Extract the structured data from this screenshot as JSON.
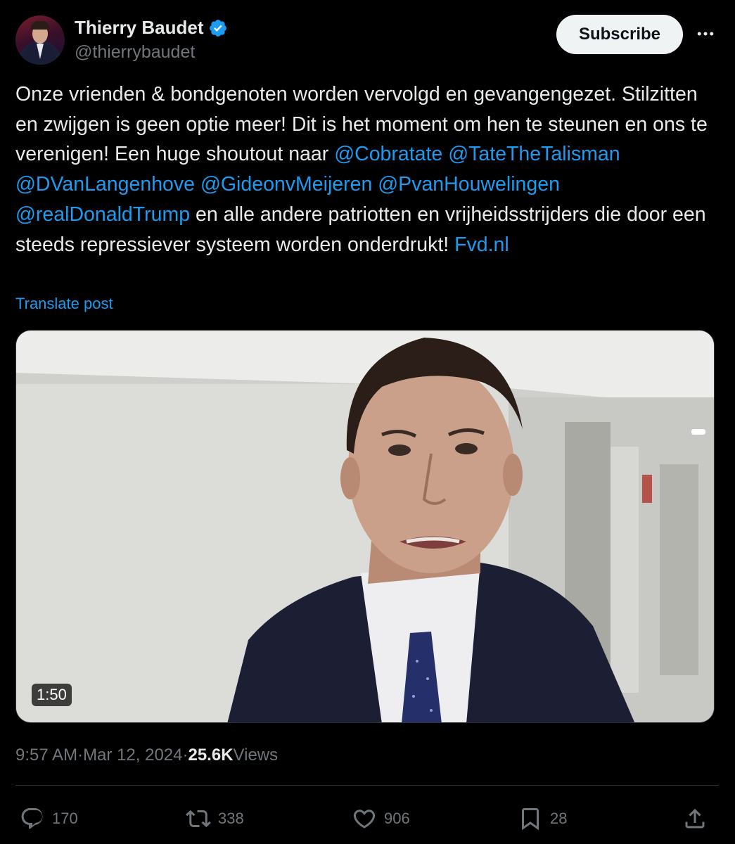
{
  "author": {
    "name": "Thierry Baudet",
    "handle": "@thierrybaudet",
    "verified": true,
    "verified_color": "#1d9bf0"
  },
  "header": {
    "subscribe_label": "Subscribe",
    "more_icon": "more-horizontal-icon"
  },
  "post": {
    "text_segments": [
      {
        "type": "text",
        "value": "Onze vrienden & bondgenoten worden vervolgd en gevangengezet. Stilzitten en zwijgen is geen optie meer! Dit is het moment om hen te steunen en ons te verenigen! Een huge shoutout naar "
      },
      {
        "type": "mention",
        "value": "@Cobratate"
      },
      {
        "type": "text",
        "value": " "
      },
      {
        "type": "mention",
        "value": "@TateTheTalisman"
      },
      {
        "type": "text",
        "value": " "
      },
      {
        "type": "mention",
        "value": "@DVanLangenhove"
      },
      {
        "type": "text",
        "value": " "
      },
      {
        "type": "mention",
        "value": "@GideonvMeijeren"
      },
      {
        "type": "text",
        "value": " "
      },
      {
        "type": "mention",
        "value": "@PvanHouwelingen"
      },
      {
        "type": "text",
        "value": " "
      },
      {
        "type": "mention",
        "value": "@realDonaldTrump"
      },
      {
        "type": "text",
        "value": " en alle andere patriotten en vrijheidsstrijders die door een steeds repressiever systeem worden onderdrukt! "
      },
      {
        "type": "link",
        "value": "Fvd.nl"
      }
    ],
    "translate_label": "Translate post"
  },
  "media": {
    "type": "video",
    "duration": "1:50"
  },
  "meta": {
    "time": "9:57 AM",
    "separator": " · ",
    "date": "Mar 12, 2024",
    "views_count": "25.6K",
    "views_label": " Views"
  },
  "actions": {
    "replies": {
      "icon": "reply-icon",
      "count": "170"
    },
    "reposts": {
      "icon": "repost-icon",
      "count": "338"
    },
    "likes": {
      "icon": "heart-icon",
      "count": "906"
    },
    "bookmarks": {
      "icon": "bookmark-icon",
      "count": "28"
    },
    "share": {
      "icon": "share-icon"
    }
  },
  "colors": {
    "background": "#000000",
    "text_primary": "#e7e9ea",
    "text_secondary": "#71767b",
    "accent": "#1d9bf0",
    "border": "#2f3336"
  }
}
